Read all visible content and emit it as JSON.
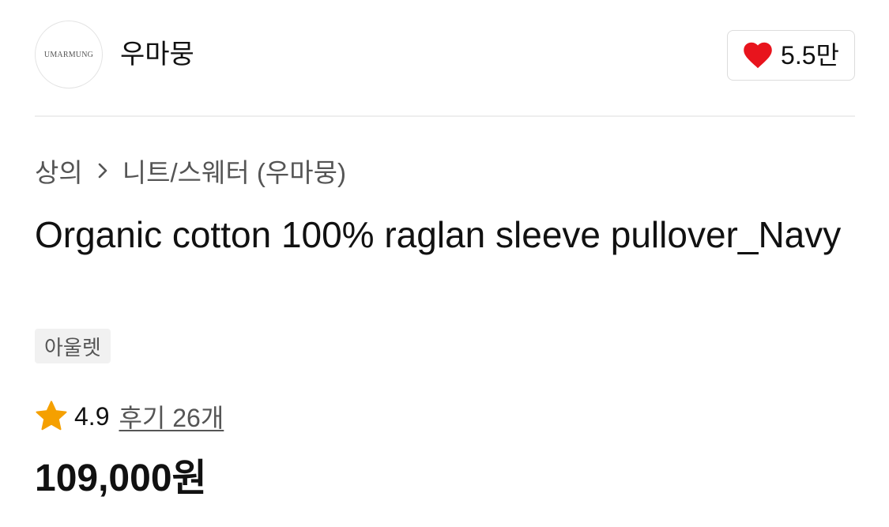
{
  "brand": {
    "logo_text": "UMARMUNG",
    "name": "우마뭉",
    "likes": "5.5만"
  },
  "breadcrumb": {
    "category": "상의",
    "subcategory": "니트/스웨터 (우마뭉)"
  },
  "product": {
    "title": "Organic cotton 100% raglan sleeve pullover_Navy",
    "tag": "아울렛",
    "rating": "4.9",
    "reviews": "후기 26개",
    "price": "109,000원"
  },
  "icons": {
    "like": "heart-icon",
    "rating": "star-icon",
    "breadcrumb_separator": "chevron-right-icon"
  },
  "colors": {
    "heart": "#e8141d",
    "star": "#f5a000",
    "text": "#111111",
    "muted_text": "#555555",
    "tag_background": "#f1f1f1"
  }
}
